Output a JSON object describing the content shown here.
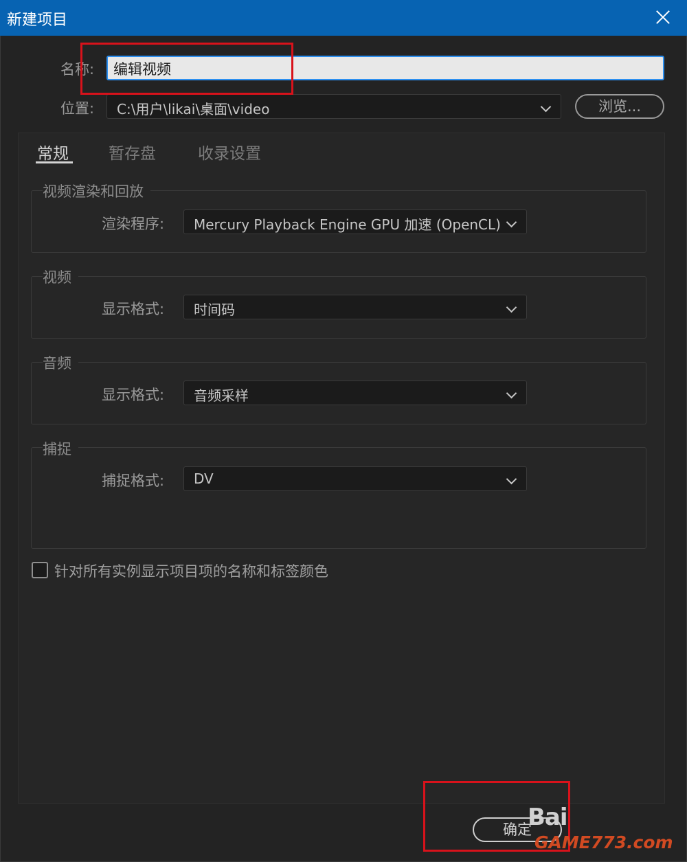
{
  "dialog": {
    "title": "新建项目"
  },
  "name_field": {
    "label": "名称:",
    "value": "编辑视频"
  },
  "location": {
    "label": "位置:",
    "value": "C:\\用户\\likai\\桌面\\video",
    "browse_label": "浏览..."
  },
  "tabs": [
    {
      "label": "常规",
      "active": true
    },
    {
      "label": "暂存盘",
      "active": false
    },
    {
      "label": "收录设置",
      "active": false
    }
  ],
  "groups": {
    "render": {
      "title": "视频渲染和回放",
      "field_label": "渲染程序:",
      "value": "Mercury Playback Engine GPU 加速 (OpenCL)"
    },
    "video": {
      "title": "视频",
      "field_label": "显示格式:",
      "value": "时间码"
    },
    "audio": {
      "title": "音频",
      "field_label": "显示格式:",
      "value": "音频采样"
    },
    "capture": {
      "title": "捕捉",
      "field_label": "捕捉格式:",
      "value": "DV"
    }
  },
  "checkbox": {
    "label": "针对所有实例显示项目项的名称和标签颜色",
    "checked": false
  },
  "ok_button": {
    "label": "确定"
  },
  "watermarks": {
    "baidu": "Bai",
    "site": "GAME773.com"
  },
  "colors": {
    "titlebar": "#0763b2",
    "background": "#232323",
    "highlight": "#d8121b",
    "input_focus": "#2c8ff0"
  }
}
